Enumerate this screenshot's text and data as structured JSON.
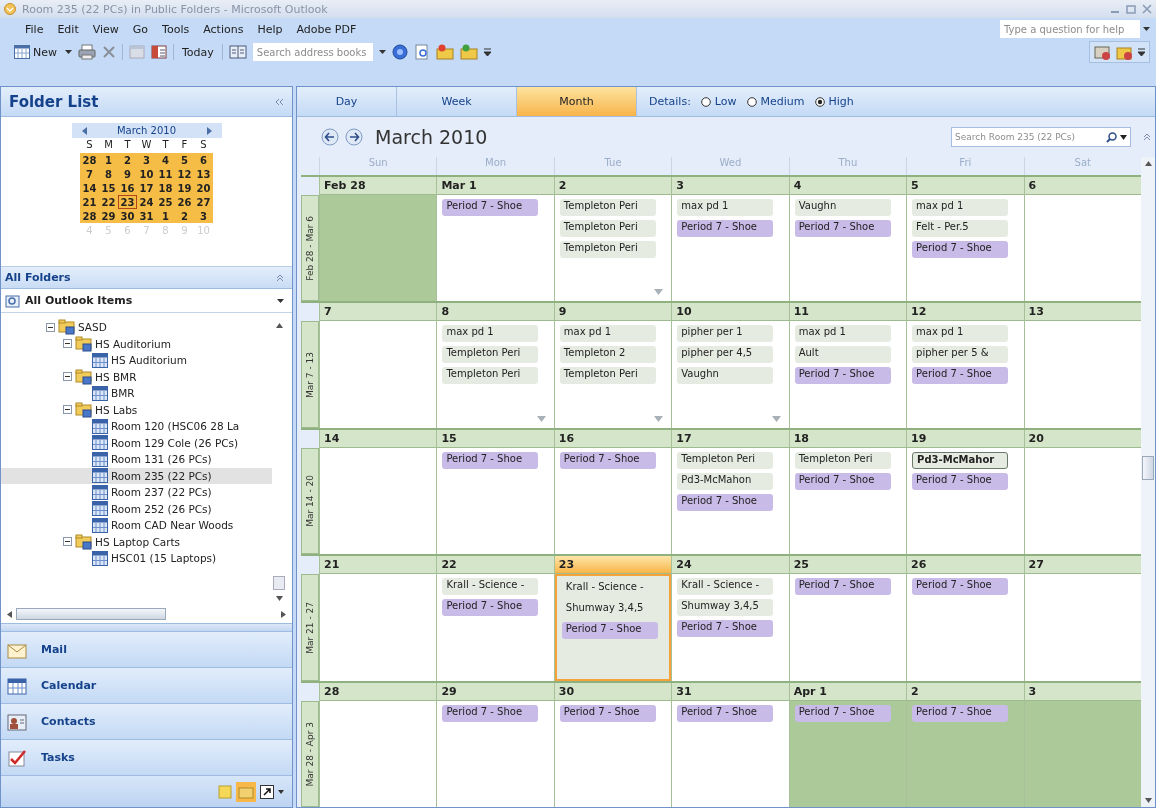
{
  "window": {
    "title": "Room 235 (22 PCs) in Public Folders - Microsoft Outlook"
  },
  "menu": [
    "File",
    "Edit",
    "View",
    "Go",
    "Tools",
    "Actions",
    "Help",
    "Adobe PDF"
  ],
  "help_box": {
    "placeholder": "Type a question for help"
  },
  "toolbar": {
    "new_label": "New",
    "today_label": "Today",
    "address_search": {
      "placeholder": "Search address books"
    }
  },
  "folder_pane": {
    "title": "Folder List",
    "mini_calendar": {
      "month": "March 2010",
      "weekdays": [
        "S",
        "M",
        "T",
        "W",
        "T",
        "F",
        "S"
      ],
      "weeks": [
        [
          {
            "day": "28",
            "selected": true,
            "today": false
          },
          {
            "day": "1",
            "selected": true,
            "today": false
          },
          {
            "day": "2",
            "selected": true,
            "today": false
          },
          {
            "day": "3",
            "selected": true,
            "today": false
          },
          {
            "day": "4",
            "selected": true,
            "today": false
          },
          {
            "day": "5",
            "selected": true,
            "today": false
          },
          {
            "day": "6",
            "selected": true,
            "today": false
          }
        ],
        [
          {
            "day": "7",
            "selected": true,
            "today": false
          },
          {
            "day": "8",
            "selected": true,
            "today": false
          },
          {
            "day": "9",
            "selected": true,
            "today": false
          },
          {
            "day": "10",
            "selected": true,
            "today": false
          },
          {
            "day": "11",
            "selected": true,
            "today": false
          },
          {
            "day": "12",
            "selected": true,
            "today": false
          },
          {
            "day": "13",
            "selected": true,
            "today": false
          }
        ],
        [
          {
            "day": "14",
            "selected": true,
            "today": false
          },
          {
            "day": "15",
            "selected": true,
            "today": false
          },
          {
            "day": "16",
            "selected": true,
            "today": false
          },
          {
            "day": "17",
            "selected": true,
            "today": false
          },
          {
            "day": "18",
            "selected": true,
            "today": false
          },
          {
            "day": "19",
            "selected": true,
            "today": false
          },
          {
            "day": "20",
            "selected": true,
            "today": false
          }
        ],
        [
          {
            "day": "21",
            "selected": true,
            "today": false
          },
          {
            "day": "22",
            "selected": true,
            "today": false
          },
          {
            "day": "23",
            "selected": true,
            "today": true
          },
          {
            "day": "24",
            "selected": true,
            "today": false
          },
          {
            "day": "25",
            "selected": true,
            "today": false
          },
          {
            "day": "26",
            "selected": true,
            "today": false
          },
          {
            "day": "27",
            "selected": true,
            "today": false
          }
        ],
        [
          {
            "day": "28",
            "selected": true,
            "today": false
          },
          {
            "day": "29",
            "selected": true,
            "today": false
          },
          {
            "day": "30",
            "selected": true,
            "today": false
          },
          {
            "day": "31",
            "selected": true,
            "today": false
          },
          {
            "day": "1",
            "selected": true,
            "today": false
          },
          {
            "day": "2",
            "selected": true,
            "today": false
          },
          {
            "day": "3",
            "selected": true,
            "today": false
          }
        ],
        [
          {
            "day": "4",
            "selected": false,
            "today": false
          },
          {
            "day": "5",
            "selected": false,
            "today": false
          },
          {
            "day": "6",
            "selected": false,
            "today": false
          },
          {
            "day": "7",
            "selected": false,
            "today": false
          },
          {
            "day": "8",
            "selected": false,
            "today": false
          },
          {
            "day": "9",
            "selected": false,
            "today": false
          },
          {
            "day": "10",
            "selected": false,
            "today": false
          }
        ]
      ]
    },
    "section_title": "All Folders",
    "root_selector": "All Outlook Items",
    "tree": [
      {
        "label": "SASD",
        "kind": "folder",
        "expanded": true,
        "selected": false,
        "children": [
          {
            "label": "HS Auditorium",
            "kind": "folder",
            "expanded": true,
            "selected": false,
            "children": [
              {
                "label": "HS Auditorium",
                "kind": "calendar",
                "selected": false
              }
            ]
          },
          {
            "label": "HS BMR",
            "kind": "folder",
            "expanded": true,
            "selected": false,
            "children": [
              {
                "label": "BMR",
                "kind": "calendar",
                "selected": false
              }
            ]
          },
          {
            "label": "HS Labs",
            "kind": "folder",
            "expanded": true,
            "selected": false,
            "children": [
              {
                "label": "Room 120 (HSC06 28 La",
                "kind": "calendar",
                "selected": false
              },
              {
                "label": "Room 129 Cole (26 PCs)",
                "kind": "calendar",
                "selected": false
              },
              {
                "label": "Room 131 (26 PCs)",
                "kind": "calendar",
                "selected": false
              },
              {
                "label": "Room 235 (22 PCs)",
                "kind": "calendar",
                "selected": true
              },
              {
                "label": "Room 237 (22 PCs)",
                "kind": "calendar",
                "selected": false
              },
              {
                "label": "Room 252 (26 PCs)",
                "kind": "calendar",
                "selected": false
              },
              {
                "label": "Room CAD Near Woods",
                "kind": "calendar",
                "selected": false
              }
            ]
          },
          {
            "label": "HS Laptop Carts",
            "kind": "folder",
            "expanded": true,
            "selected": false,
            "children": [
              {
                "label": "HSC01 (15 Laptops)",
                "kind": "calendar",
                "selected": false
              }
            ]
          }
        ]
      }
    ],
    "nav": [
      {
        "label": "Mail",
        "kind": "mail"
      },
      {
        "label": "Calendar",
        "kind": "calendar"
      },
      {
        "label": "Contacts",
        "kind": "contacts"
      },
      {
        "label": "Tasks",
        "kind": "tasks"
      }
    ]
  },
  "view_tabs": [
    {
      "label": "Day",
      "selected": false
    },
    {
      "label": "Week",
      "selected": false
    },
    {
      "label": "Month",
      "selected": true
    }
  ],
  "details": {
    "label": "Details:",
    "options": [
      {
        "label": "Low",
        "selected": false
      },
      {
        "label": "Medium",
        "selected": false
      },
      {
        "label": "High",
        "selected": true
      }
    ]
  },
  "calendar": {
    "title": "March 2010",
    "search": {
      "placeholder": "Search Room 235 (22 PCs)"
    },
    "day_names": [
      "Sun",
      "Mon",
      "Tue",
      "Wed",
      "Thu",
      "Fri",
      "Sat"
    ],
    "weeks": [
      {
        "label": "Feb 28 - Mar 6",
        "days": [
          {
            "date": "Feb 28",
            "shaded": true,
            "today": false,
            "more": false
          },
          {
            "date": "Mar 1",
            "shaded": false,
            "today": false,
            "more": false,
            "events": [
              {
                "text": "Period 7 - Shoe",
                "color": "#c9bbe8",
                "selected": false
              }
            ]
          },
          {
            "date": "2",
            "shaded": false,
            "today": false,
            "more": true,
            "events": [
              {
                "text": "Templeton Peri",
                "color": "#e6ebe2",
                "selected": false
              },
              {
                "text": "Templeton Peri",
                "color": "#e6ebe2",
                "selected": false
              },
              {
                "text": "Templeton Peri",
                "color": "#e6ebe2",
                "selected": false
              }
            ]
          },
          {
            "date": "3",
            "shaded": false,
            "today": false,
            "more": false,
            "events": [
              {
                "text": "max pd 1",
                "color": "#e6ebe2",
                "selected": false
              },
              {
                "text": "Period 7 - Shoe",
                "color": "#c9bbe8",
                "selected": false
              }
            ]
          },
          {
            "date": "4",
            "shaded": false,
            "today": false,
            "more": false,
            "events": [
              {
                "text": "Vaughn",
                "color": "#e6ebe2",
                "selected": false
              },
              {
                "text": "Period 7 - Shoe",
                "color": "#c9bbe8",
                "selected": false
              }
            ]
          },
          {
            "date": "5",
            "shaded": false,
            "today": false,
            "more": false,
            "events": [
              {
                "text": "max pd 1",
                "color": "#e6ebe2",
                "selected": false
              },
              {
                "text": "Felt - Per.5",
                "color": "#e6ebe2",
                "selected": false
              },
              {
                "text": "Period 7 - Shoe",
                "color": "#c9bbe8",
                "selected": false
              }
            ]
          },
          {
            "date": "6",
            "shaded": false,
            "today": false,
            "more": false
          }
        ]
      },
      {
        "label": "Mar 7 - 13",
        "days": [
          {
            "date": "7",
            "shaded": false,
            "today": false,
            "more": false
          },
          {
            "date": "8",
            "shaded": false,
            "today": false,
            "more": true,
            "events": [
              {
                "text": "max pd 1",
                "color": "#e6ebe2",
                "selected": false
              },
              {
                "text": "Templeton Peri",
                "color": "#e6ebe2",
                "selected": false
              },
              {
                "text": "Templeton Peri",
                "color": "#e6ebe2",
                "selected": false
              }
            ]
          },
          {
            "date": "9",
            "shaded": false,
            "today": false,
            "more": true,
            "events": [
              {
                "text": "max pd 1",
                "color": "#e6ebe2",
                "selected": false
              },
              {
                "text": "Templeton 2",
                "color": "#e6ebe2",
                "selected": false
              },
              {
                "text": "Templeton Peri",
                "color": "#e6ebe2",
                "selected": false
              }
            ]
          },
          {
            "date": "10",
            "shaded": false,
            "today": false,
            "more": true,
            "events": [
              {
                "text": "pipher per 1",
                "color": "#e6ebe2",
                "selected": false
              },
              {
                "text": "pipher per 4,5",
                "color": "#e6ebe2",
                "selected": false
              },
              {
                "text": "Vaughn",
                "color": "#e6ebe2",
                "selected": false
              }
            ]
          },
          {
            "date": "11",
            "shaded": false,
            "today": false,
            "more": false,
            "events": [
              {
                "text": "max pd 1",
                "color": "#e6ebe2",
                "selected": false
              },
              {
                "text": "Ault",
                "color": "#e6ebe2",
                "selected": false
              },
              {
                "text": "Period 7 - Shoe",
                "color": "#c9bbe8",
                "selected": false
              }
            ]
          },
          {
            "date": "12",
            "shaded": false,
            "today": false,
            "more": false,
            "events": [
              {
                "text": "max pd 1",
                "color": "#e6ebe2",
                "selected": false
              },
              {
                "text": "pipher per 5 &",
                "color": "#e6ebe2",
                "selected": false
              },
              {
                "text": "Period 7 - Shoe",
                "color": "#c9bbe8",
                "selected": false
              }
            ]
          },
          {
            "date": "13",
            "shaded": false,
            "today": false,
            "more": false
          }
        ]
      },
      {
        "label": "Mar 14 - 20",
        "days": [
          {
            "date": "14",
            "shaded": false,
            "today": false,
            "more": false
          },
          {
            "date": "15",
            "shaded": false,
            "today": false,
            "more": false,
            "events": [
              {
                "text": "Period 7 - Shoe",
                "color": "#c9bbe8",
                "selected": false
              }
            ]
          },
          {
            "date": "16",
            "shaded": false,
            "today": false,
            "more": false,
            "events": [
              {
                "text": "Period 7 - Shoe",
                "color": "#c9bbe8",
                "selected": false
              }
            ]
          },
          {
            "date": "17",
            "shaded": false,
            "today": false,
            "more": false,
            "events": [
              {
                "text": "Templeton Peri",
                "color": "#e6ebe2",
                "selected": false
              },
              {
                "text": "Pd3-McMahon",
                "color": "#e6ebe2",
                "selected": false
              },
              {
                "text": "Period 7 - Shoe",
                "color": "#c9bbe8",
                "selected": false
              }
            ]
          },
          {
            "date": "18",
            "shaded": false,
            "today": false,
            "more": false,
            "events": [
              {
                "text": "Templeton Peri",
                "color": "#e6ebe2",
                "selected": false
              },
              {
                "text": "Period 7 - Shoe",
                "color": "#c9bbe8",
                "selected": false
              }
            ]
          },
          {
            "date": "19",
            "shaded": false,
            "today": false,
            "more": false,
            "events": [
              {
                "text": "Pd3-McMahor",
                "color": "#e6ebe2",
                "selected": true
              },
              {
                "text": "Period 7 - Shoe",
                "color": "#c9bbe8",
                "selected": false
              }
            ]
          },
          {
            "date": "20",
            "shaded": false,
            "today": false,
            "more": false
          }
        ]
      },
      {
        "label": "Mar 21 - 27",
        "days": [
          {
            "date": "21",
            "shaded": false,
            "today": false,
            "more": false
          },
          {
            "date": "22",
            "shaded": false,
            "today": false,
            "more": false,
            "events": [
              {
                "text": "Krall - Science -",
                "color": "#e6ebe2",
                "selected": false
              },
              {
                "text": "Period 7 - Shoe",
                "color": "#c9bbe8",
                "selected": false
              }
            ]
          },
          {
            "date": "23",
            "shaded": false,
            "today": true,
            "more": false,
            "events": [
              {
                "text": "Krall - Science -",
                "color": "#e6ebe2",
                "selected": false
              },
              {
                "text": "Shumway 3,4,5",
                "color": "#e6ebe2",
                "selected": false
              },
              {
                "text": "Period 7 - Shoe",
                "color": "#c9bbe8",
                "selected": false
              }
            ]
          },
          {
            "date": "24",
            "shaded": false,
            "today": false,
            "more": false,
            "events": [
              {
                "text": "Krall - Science -",
                "color": "#e6ebe2",
                "selected": false
              },
              {
                "text": "Shumway 3,4,5",
                "color": "#e6ebe2",
                "selected": false
              },
              {
                "text": "Period 7 - Shoe",
                "color": "#c9bbe8",
                "selected": false
              }
            ]
          },
          {
            "date": "25",
            "shaded": false,
            "today": false,
            "more": false,
            "events": [
              {
                "text": "Period 7 - Shoe",
                "color": "#c9bbe8",
                "selected": false
              }
            ]
          },
          {
            "date": "26",
            "shaded": false,
            "today": false,
            "more": false,
            "events": [
              {
                "text": "Period 7 - Shoe",
                "color": "#c9bbe8",
                "selected": false
              }
            ]
          },
          {
            "date": "27",
            "shaded": false,
            "today": false,
            "more": false
          }
        ]
      },
      {
        "label": "Mar 28 - Apr 3",
        "days": [
          {
            "date": "28",
            "shaded": false,
            "today": false,
            "more": false
          },
          {
            "date": "29",
            "shaded": false,
            "today": false,
            "more": false,
            "events": [
              {
                "text": "Period 7 - Shoe",
                "color": "#c9bbe8",
                "selected": false
              }
            ]
          },
          {
            "date": "30",
            "shaded": false,
            "today": false,
            "more": false,
            "events": [
              {
                "text": "Period 7 - Shoe",
                "color": "#c9bbe8",
                "selected": false
              }
            ]
          },
          {
            "date": "31",
            "shaded": false,
            "today": false,
            "more": false,
            "events": [
              {
                "text": "Period 7 - Shoe",
                "color": "#c9bbe8",
                "selected": false
              }
            ]
          },
          {
            "date": "Apr 1",
            "shaded": true,
            "today": false,
            "more": false,
            "events": [
              {
                "text": "Period 7 - Shoe",
                "color": "#c9bbe8",
                "selected": false
              }
            ]
          },
          {
            "date": "2",
            "shaded": true,
            "today": false,
            "more": false,
            "events": [
              {
                "text": "Period 7 - Shoe",
                "color": "#c9bbe8",
                "selected": false
              }
            ]
          },
          {
            "date": "3",
            "shaded": true,
            "today": false,
            "more": false
          }
        ]
      }
    ]
  }
}
